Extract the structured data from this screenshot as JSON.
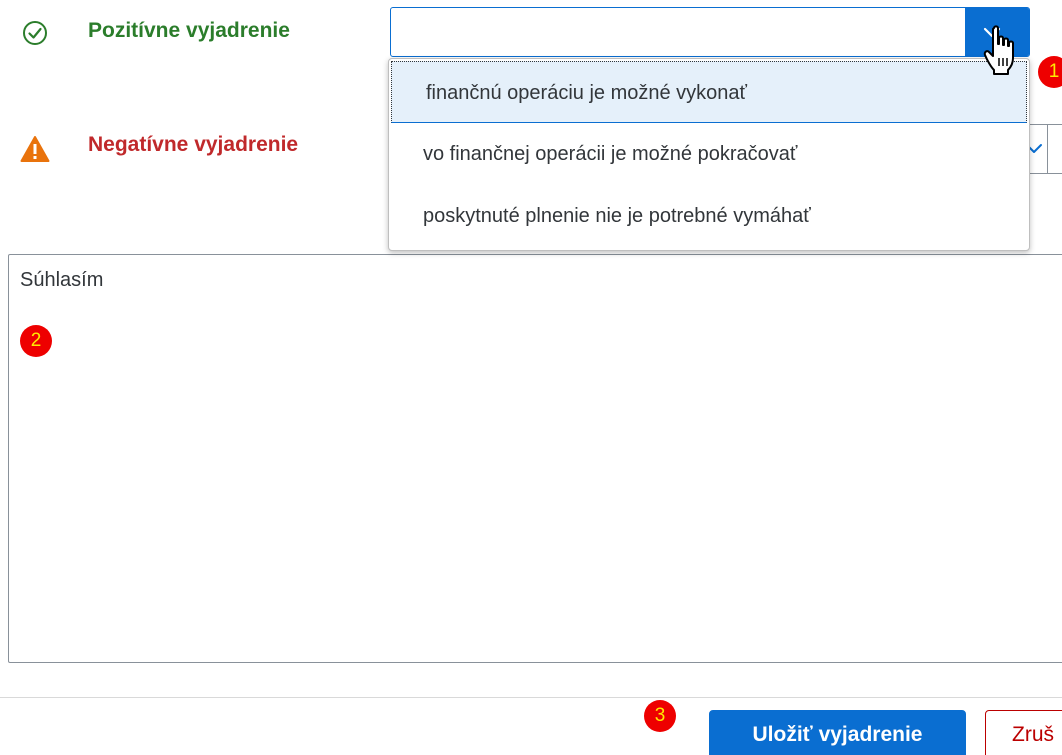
{
  "positive": {
    "label": "Pozitívne vyjadrenie",
    "icon": "check-circle-icon",
    "color": "#2b7d2b",
    "value": "",
    "placeholder": ""
  },
  "negative": {
    "label": "Negatívne vyjadrenie",
    "icon": "warning-triangle-icon",
    "color": "#c0292b"
  },
  "dropdown": {
    "options": [
      "finančnú operáciu je možné vykonať",
      "vo finančnej operácii je možné pokračovať",
      "poskytnuté plnenie nie je potrebné vymáhať"
    ],
    "highlighted_index": 0
  },
  "comment": {
    "text": "Súhlasím"
  },
  "badges": [
    "1",
    "2",
    "3"
  ],
  "footer": {
    "save_label": "Uložiť vyjadrenie",
    "cancel_label": "Zruš"
  },
  "colors": {
    "accent": "#0a6ed1",
    "badge": "#ee0000",
    "badge_text": "#ffea00",
    "cancel": "#bb0000"
  }
}
